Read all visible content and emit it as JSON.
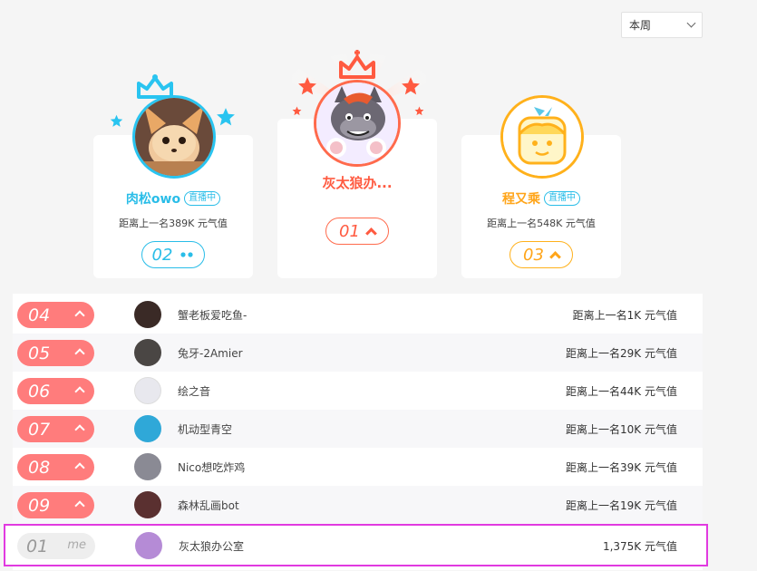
{
  "period": {
    "selected": "本周"
  },
  "podium": [
    {
      "rank": "01",
      "name": "灰太狼办...",
      "gap": "",
      "live": "",
      "color": "#ff5a40"
    },
    {
      "rank": "02",
      "name": "肉松owo",
      "gap": "距离上一名389K 元气值",
      "live": "直播中",
      "color": "#29bde8"
    },
    {
      "rank": "03",
      "name": "程又乘",
      "gap": "距离上一名548K 元气值",
      "live": "直播中",
      "color": "#ffa51a"
    }
  ],
  "rows": [
    {
      "rank": "04",
      "name": "蟹老板爱吃鱼-",
      "gap": "距离上一名1K 元气值",
      "avatar": "#3a2a26"
    },
    {
      "rank": "05",
      "name": "兔牙-2Amier",
      "gap": "距离上一名29K 元气值",
      "avatar": "#4a4644"
    },
    {
      "rank": "06",
      "name": "绘之音",
      "gap": "距离上一名44K 元气值",
      "avatar": "#e8e8ee"
    },
    {
      "rank": "07",
      "name": "机动型青空",
      "gap": "距离上一名10K 元气值",
      "avatar": "#2fa8d8"
    },
    {
      "rank": "08",
      "name": "Nico想吃炸鸡",
      "gap": "距离上一名39K 元气值",
      "avatar": "#8a8a94"
    },
    {
      "rank": "09",
      "name": "森林乱画bot",
      "gap": "距离上一名19K 元气值",
      "avatar": "#5a3030"
    }
  ],
  "me": {
    "rank": "01",
    "tag": "me",
    "name": "灰太狼办公室",
    "value": "1,375K 元气值",
    "avatar": "#b58bd6"
  },
  "icons": {
    "select": "chevron-down-icon",
    "up": "arrow-up-icon",
    "same": "dots-icon",
    "crown": "crown-icon",
    "star": "star-icon"
  }
}
